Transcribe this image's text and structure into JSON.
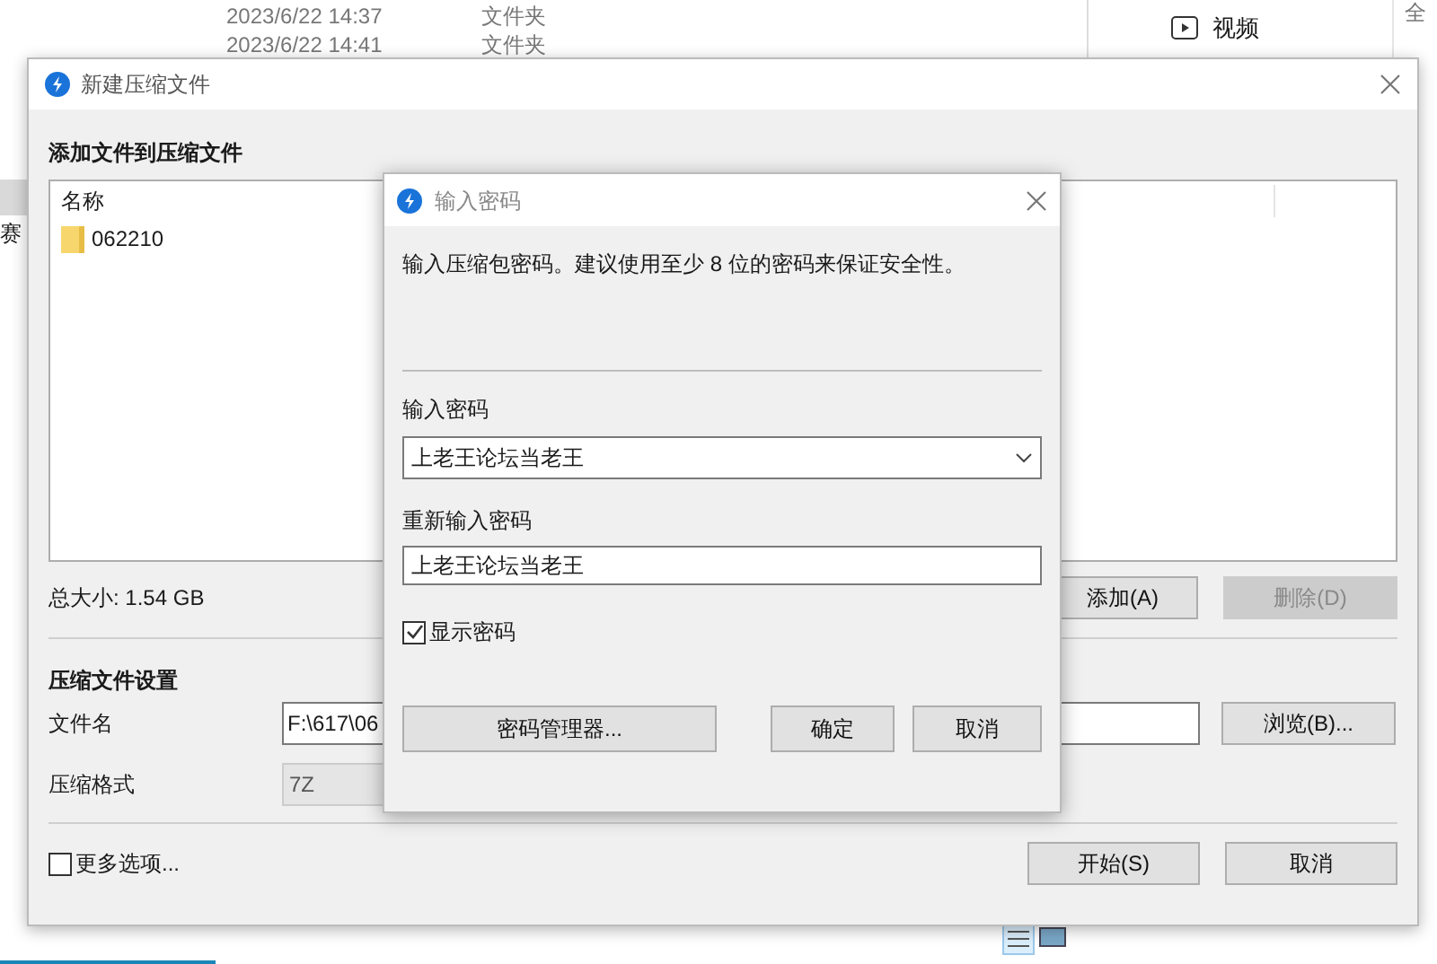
{
  "background_window": {
    "rows": [
      {
        "date": "2023/6/22 14:37",
        "type": "文件夹"
      },
      {
        "date": "2023/6/22 14:41",
        "type": "文件夹"
      }
    ],
    "nav_item": "视频",
    "right_label": "全",
    "left_label": "赛"
  },
  "main_dialog": {
    "title": "新建压缩文件",
    "section_title": "添加文件到压缩文件",
    "list_header": "名称",
    "files": [
      {
        "name": "062210",
        "selected": false
      }
    ],
    "total_size": "总大小: 1.54 GB",
    "add_button": {
      "label": "添加(A)",
      "disabled": false
    },
    "delete_button": {
      "label": "删除(D)",
      "disabled": true
    },
    "settings_title": "压缩文件设置",
    "filename_label": "文件名",
    "filename_value": "F:\\617\\06",
    "browse_button": "浏览(B)...",
    "format_label": "压缩格式",
    "format_value": "7Z",
    "more_options": {
      "label": "更多选项...",
      "checked": false
    },
    "start_button": "开始(S)",
    "cancel_button": "取消"
  },
  "password_dialog": {
    "title": "输入密码",
    "instruction": "输入压缩包密码。建议使用至少 8 位的密码来保证安全性。",
    "password_label": "输入密码",
    "password_value": "上老王论坛当老王",
    "confirm_label": "重新输入密码",
    "confirm_value": "上老王论坛当老王",
    "show_password": {
      "label": "显示密码",
      "checked": true
    },
    "manager_button": "密码管理器...",
    "ok_button": "确定",
    "cancel_button": "取消"
  }
}
